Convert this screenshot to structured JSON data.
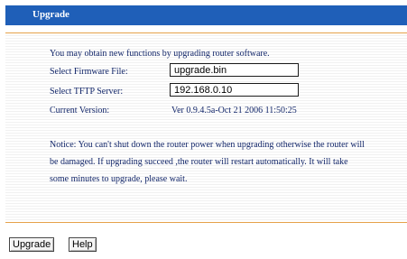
{
  "page": {
    "title": "Upgrade"
  },
  "intro": "You may obtain new functions by upgrading router software.",
  "form": {
    "firmware_label": "Select Firmware File:",
    "firmware_value": "upgrade.bin",
    "tftp_label": "Select TFTP Server:",
    "tftp_value": "192.168.0.10",
    "version_label": "Current Version:",
    "version_value": "Ver 0.9.4.5a-Oct 21 2006 11:50:25"
  },
  "notice": "Notice: You can't shut down the router power when upgrading otherwise the router will be damaged. If upgrading succeed ,the router will restart automatically. It will take some minutes to upgrade, please wait.",
  "buttons": {
    "upgrade_label": "Upgrade",
    "help_label": "Help"
  },
  "colors": {
    "title_bar": "#1f5fb8",
    "text": "#13276a",
    "rule": "#e6a24a"
  }
}
